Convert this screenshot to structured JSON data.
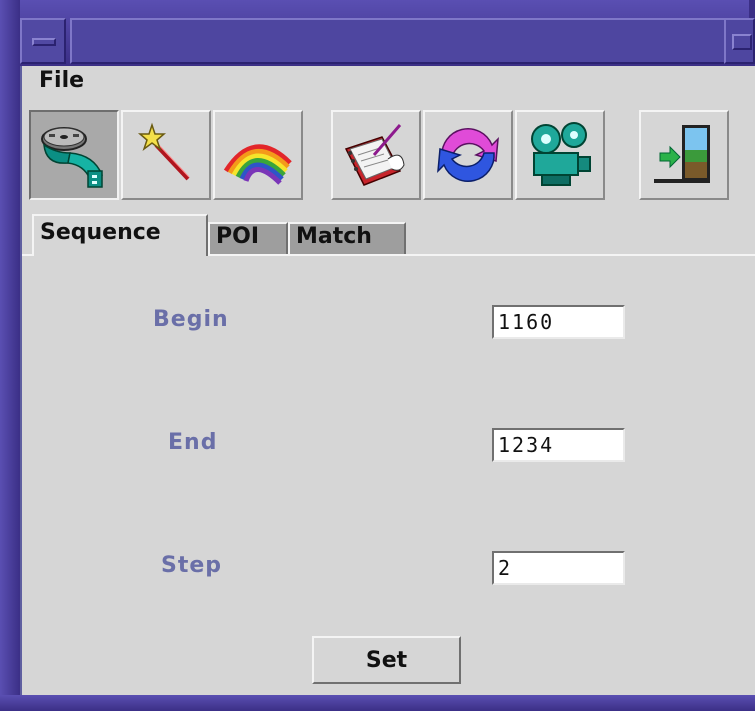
{
  "menubar": {
    "file_label": "File"
  },
  "toolbar": {
    "buttons": [
      {
        "icon": "film-reel-icon",
        "pressed": true
      },
      {
        "icon": "magic-wand-icon",
        "pressed": false
      },
      {
        "icon": "rainbow-icon",
        "pressed": false
      },
      {
        "icon": "notebook-edit-icon",
        "pressed": false
      },
      {
        "icon": "refresh-arrows-icon",
        "pressed": false
      },
      {
        "icon": "movie-projector-icon",
        "pressed": false
      },
      {
        "icon": "exit-door-icon",
        "pressed": false
      }
    ]
  },
  "tabs": [
    {
      "label": "Sequence",
      "active": true
    },
    {
      "label": "POI",
      "active": false
    },
    {
      "label": "Match",
      "active": false
    }
  ],
  "form": {
    "begin_label": "Begin",
    "begin_value": "1160",
    "end_label": "End",
    "end_value": "1234",
    "step_label": "Step",
    "step_value": "2",
    "set_label": "Set"
  },
  "colors": {
    "frame": "#4a3f9a",
    "background": "#d6d6d6",
    "label": "#6a6fa8"
  }
}
